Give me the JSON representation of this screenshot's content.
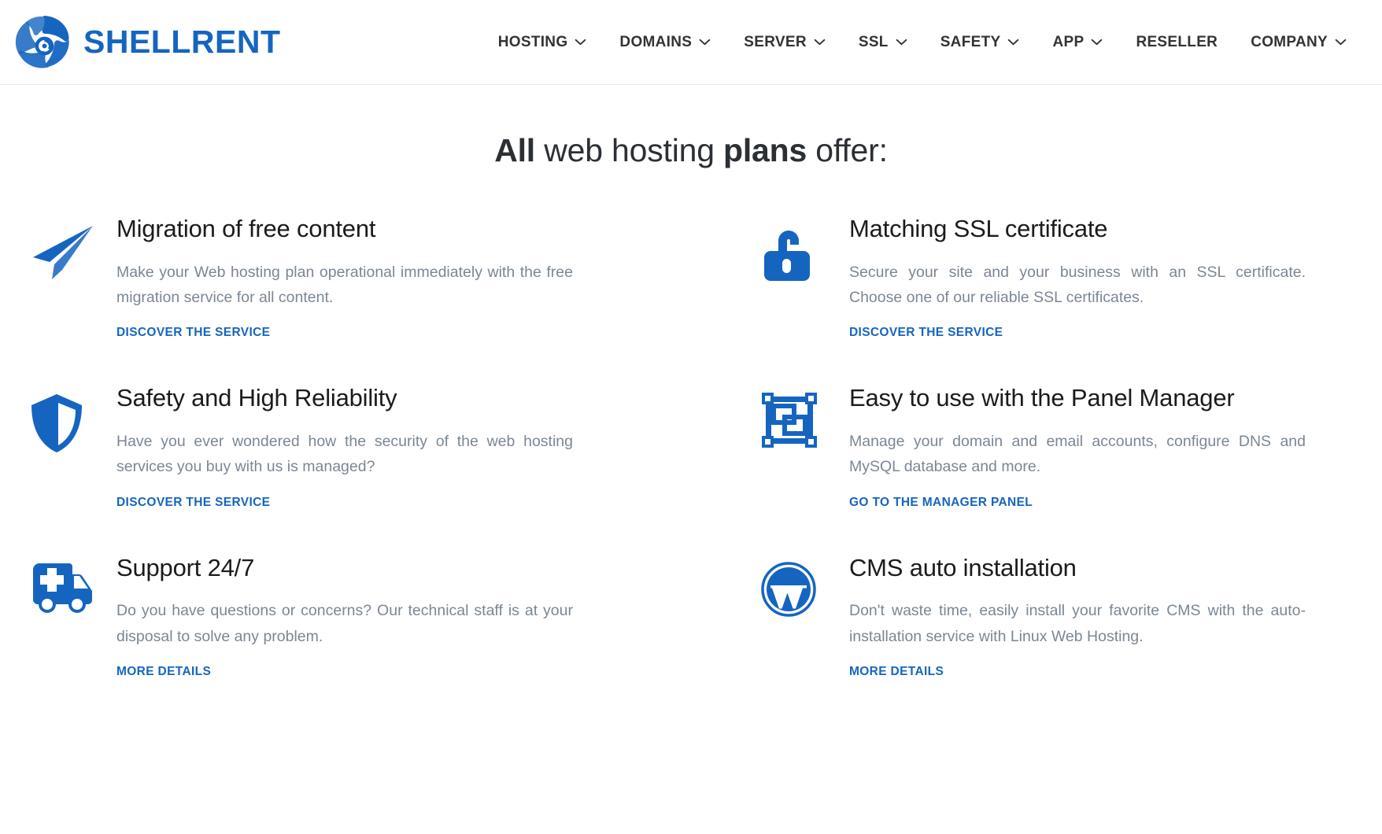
{
  "header": {
    "brand": {
      "name": "SHELLRENT",
      "logo_icon": "shell-spiral-icon",
      "color": "#1565c0"
    },
    "nav": [
      {
        "label": "HOSTING",
        "has_dropdown": true,
        "icon": "chevron-down-icon"
      },
      {
        "label": "DOMAINS",
        "has_dropdown": true,
        "icon": "chevron-down-icon"
      },
      {
        "label": "SERVER",
        "has_dropdown": true,
        "icon": "chevron-down-icon"
      },
      {
        "label": "SSL",
        "has_dropdown": true,
        "icon": "chevron-down-icon"
      },
      {
        "label": "SAFETY",
        "has_dropdown": true,
        "icon": "chevron-down-icon"
      },
      {
        "label": "APP",
        "has_dropdown": true,
        "icon": "chevron-down-icon"
      },
      {
        "label": "RESELLER",
        "has_dropdown": false,
        "icon": ""
      },
      {
        "label": "COMPANY",
        "has_dropdown": true,
        "icon": "chevron-down-icon"
      }
    ]
  },
  "main": {
    "title_part1": "All",
    "title_part2": " web hosting ",
    "title_part3": "plans",
    "title_part4": " offer:",
    "features": [
      {
        "icon": "paper-plane-icon",
        "title": "Migration of free content",
        "description": "Make your Web hosting plan operational immediately with the free migration service for all content.",
        "link_label": "DISCOVER THE SERVICE"
      },
      {
        "icon": "open-padlock-icon",
        "title": "Matching SSL certificate",
        "description": "Secure your site and your business with an SSL certificate. Choose one of our reliable SSL certificates.",
        "link_label": "DISCOVER THE SERVICE"
      },
      {
        "icon": "shield-icon",
        "title": "Safety and High Reliability",
        "description": "Have you ever wondered how the security of the web hosting services you buy with us is managed?",
        "link_label": "DISCOVER THE SERVICE"
      },
      {
        "icon": "panel-frame-icon",
        "title": "Easy to use with the Panel Manager",
        "description": "Manage your domain and email accounts, configure DNS and MySQL database and more.",
        "link_label": "GO TO THE MANAGER PANEL"
      },
      {
        "icon": "ambulance-icon",
        "title": "Support 24/7",
        "description": "Do you have questions or concerns? Our technical staff is at your disposal to solve any problem.",
        "link_label": "MORE DETAILS"
      },
      {
        "icon": "wordpress-icon",
        "title": "CMS auto installation",
        "description": "Don't waste time, easily install your favorite CMS with the auto-installation service with Linux Web Hosting.",
        "link_label": "MORE DETAILS"
      }
    ]
  },
  "colors": {
    "brand_blue": "#1565c0",
    "icon_blue": "#1565c0",
    "title_dark": "#1b1b1b",
    "body_gray": "#7b8794",
    "nav_dark": "#333333"
  }
}
